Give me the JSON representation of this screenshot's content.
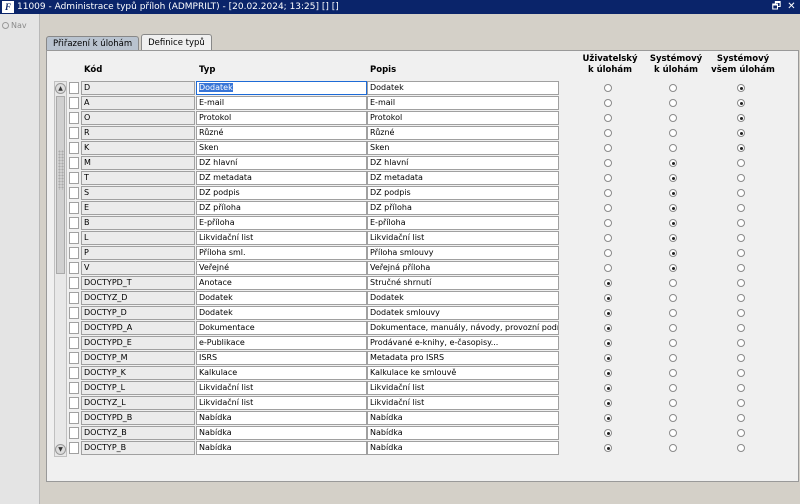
{
  "window": {
    "title": "11009 - Administrace typů příloh (ADMPRILT) - [20.02.2024; 13:25] [] []",
    "icon": "app-logo-icon"
  },
  "nav": {
    "label": "Nav"
  },
  "tabs": [
    {
      "label": "Přiřazení k úlohám",
      "active": false
    },
    {
      "label": "Definice typů",
      "active": true
    }
  ],
  "columns": {
    "kod": "Kód",
    "typ": "Typ",
    "popis": "Popis",
    "uzivatelsky": [
      "Uživatelský",
      "k úlohám"
    ],
    "systemovy": [
      "Systémový",
      "k úlohám"
    ],
    "systemovy_vsem": [
      "Systémový",
      "všem úlohám"
    ]
  },
  "rows": [
    {
      "kod": "D",
      "typ": "Dodatek",
      "popis": "Dodatek",
      "choice": 2,
      "typ_selected": true
    },
    {
      "kod": "A",
      "typ": "E-mail",
      "popis": "E-mail",
      "choice": 2
    },
    {
      "kod": "O",
      "typ": "Protokol",
      "popis": "Protokol",
      "choice": 2
    },
    {
      "kod": "R",
      "typ": "Různé",
      "popis": "Různé",
      "choice": 2
    },
    {
      "kod": "K",
      "typ": "Sken",
      "popis": "Sken",
      "choice": 2
    },
    {
      "kod": "M",
      "typ": "DZ hlavní",
      "popis": "DZ hlavní",
      "choice": 1
    },
    {
      "kod": "T",
      "typ": "DZ metadata",
      "popis": "DZ metadata",
      "choice": 1
    },
    {
      "kod": "S",
      "typ": "DZ podpis",
      "popis": "DZ podpis",
      "choice": 1
    },
    {
      "kod": "E",
      "typ": "DZ příloha",
      "popis": "DZ příloha",
      "choice": 1
    },
    {
      "kod": "B",
      "typ": "E-příloha",
      "popis": "E-příloha",
      "choice": 1
    },
    {
      "kod": "L",
      "typ": "Likvidační list",
      "popis": "Likvidační list",
      "choice": 1
    },
    {
      "kod": "P",
      "typ": "Příloha sml.",
      "popis": "Příloha smlouvy",
      "choice": 1
    },
    {
      "kod": "V",
      "typ": "Veřejné",
      "popis": "Veřejná příloha",
      "choice": 1
    },
    {
      "kod": "DOCTYPD_T",
      "typ": "Anotace",
      "popis": "Stručné shrnutí",
      "choice": 0
    },
    {
      "kod": "DOCTYZ_D",
      "typ": "Dodatek",
      "popis": "Dodatek",
      "choice": 0
    },
    {
      "kod": "DOCTYP_D",
      "typ": "Dodatek",
      "popis": "Dodatek smlouvy",
      "choice": 0
    },
    {
      "kod": "DOCTYPD_A",
      "typ": "Dokumentace",
      "popis": "Dokumentace, manuály, návody, provozní podmín",
      "choice": 0
    },
    {
      "kod": "DOCTYPD_E",
      "typ": "e-Publikace",
      "popis": "Prodávané e-knihy, e-časopisy...",
      "choice": 0
    },
    {
      "kod": "DOCTYP_M",
      "typ": "ISRS",
      "popis": "Metadata pro ISRS",
      "choice": 0
    },
    {
      "kod": "DOCTYP_K",
      "typ": "Kalkulace",
      "popis": "Kalkulace ke smlouvě",
      "choice": 0
    },
    {
      "kod": "DOCTYP_L",
      "typ": "Likvidační list",
      "popis": "Likvidační list",
      "choice": 0
    },
    {
      "kod": "DOCTYZ_L",
      "typ": "Likvidační list",
      "popis": "Likvidační list",
      "choice": 0
    },
    {
      "kod": "DOCTYPD_B",
      "typ": "Nabídka",
      "popis": "Nabídka",
      "choice": 0
    },
    {
      "kod": "DOCTYZ_B",
      "typ": "Nabídka",
      "popis": "Nabídka",
      "choice": 0
    },
    {
      "kod": "DOCTYP_B",
      "typ": "Nabídka",
      "popis": "Nabídka",
      "choice": 0
    }
  ]
}
